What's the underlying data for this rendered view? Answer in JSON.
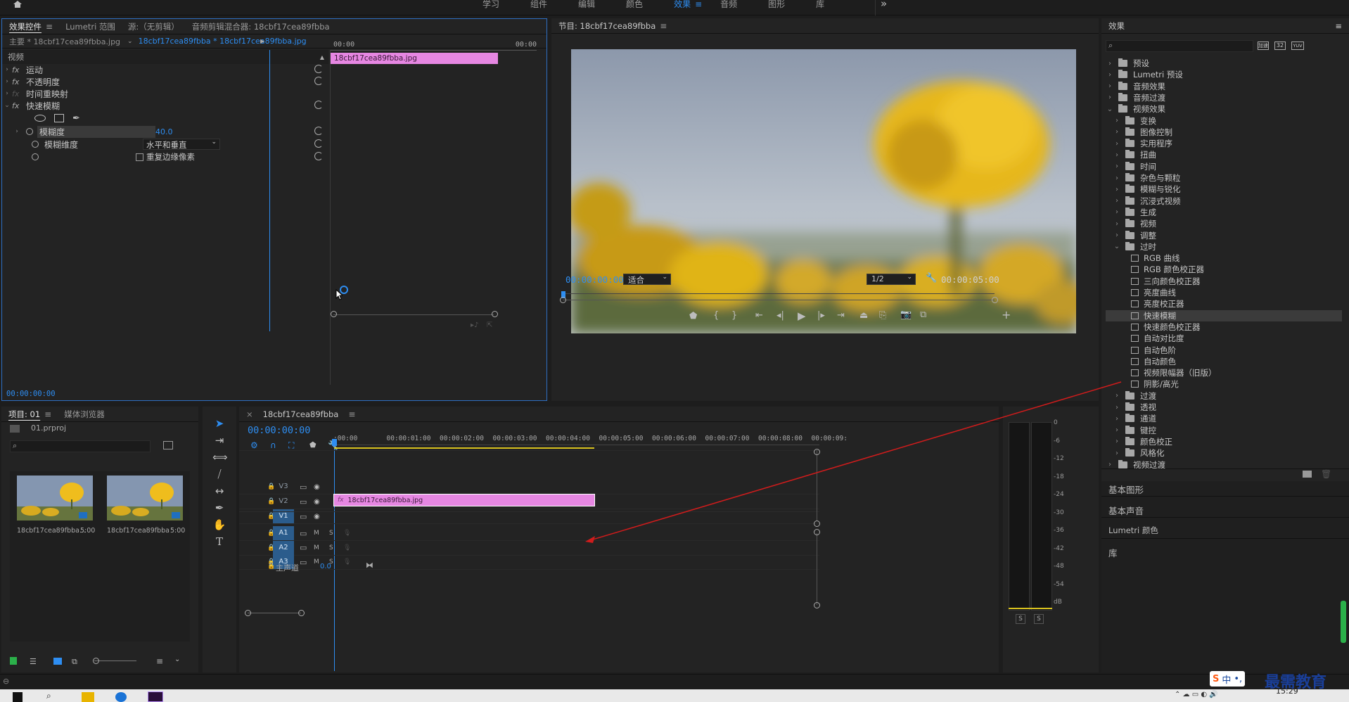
{
  "workspaces": [
    "学习",
    "组件",
    "编辑",
    "颜色",
    "效果",
    "音频",
    "图形",
    "库"
  ],
  "workspace_active_index": 4,
  "workspace_more": "»",
  "effect_controls": {
    "tabs": [
      "效果控件",
      "Lumetri 范围",
      "源:（无剪辑）",
      "音频剪辑混合器: 18cbf17cea89fbba"
    ],
    "menu_glyph": "≡",
    "master_label": "主要 * 18cbf17cea89fbba.jpg",
    "sequence_clip": "18cbf17cea89fbba * 18cbf17cea89fbba.jpg",
    "section": "视频",
    "rows": [
      {
        "fx": "fx",
        "label": "运动"
      },
      {
        "fx": "fx",
        "label": "不透明度"
      },
      {
        "fx": "fx",
        "label": "时间重映射"
      },
      {
        "fx": "fx",
        "label": "快速模糊"
      }
    ],
    "blurriness_label": "模糊度",
    "blurriness_value": "40.0",
    "blur_dim_label": "模糊维度",
    "blur_dim_value": "水平和垂直",
    "repeat_edge_label": "重复边缘像素",
    "tl_start": "00:00",
    "tl_end": "00:00",
    "clip_name": "18cbf17cea89fbba.jpg",
    "timecode": "00:00:00:00"
  },
  "program": {
    "title": "节目: 18cbf17cea89fbba",
    "timecode": "00:00:00:00",
    "fit": "适合",
    "resolution": "1/2",
    "duration": "00:00:05:00",
    "add": "+"
  },
  "effects_panel": {
    "title": "效果",
    "search_placeholder": "",
    "icons": [
      "加速",
      "32",
      "YUV"
    ],
    "tree": [
      {
        "label": "预设",
        "depth": 0,
        "open": false
      },
      {
        "label": "Lumetri 预设",
        "depth": 0,
        "open": false
      },
      {
        "label": "音频效果",
        "depth": 0,
        "open": false
      },
      {
        "label": "音频过渡",
        "depth": 0,
        "open": false
      },
      {
        "label": "视频效果",
        "depth": 0,
        "open": true
      },
      {
        "label": "变换",
        "depth": 1,
        "open": false
      },
      {
        "label": "图像控制",
        "depth": 1,
        "open": false
      },
      {
        "label": "实用程序",
        "depth": 1,
        "open": false
      },
      {
        "label": "扭曲",
        "depth": 1,
        "open": false
      },
      {
        "label": "时间",
        "depth": 1,
        "open": false
      },
      {
        "label": "杂色与颗粒",
        "depth": 1,
        "open": false
      },
      {
        "label": "模糊与锐化",
        "depth": 1,
        "open": false
      },
      {
        "label": "沉浸式视频",
        "depth": 1,
        "open": false
      },
      {
        "label": "生成",
        "depth": 1,
        "open": false
      },
      {
        "label": "视频",
        "depth": 1,
        "open": false
      },
      {
        "label": "调整",
        "depth": 1,
        "open": false
      },
      {
        "label": "过时",
        "depth": 1,
        "open": true
      },
      {
        "label": "RGB 曲线",
        "depth": 2,
        "item": true
      },
      {
        "label": "RGB 颜色校正器",
        "depth": 2,
        "item": true
      },
      {
        "label": "三向颜色校正器",
        "depth": 2,
        "item": true
      },
      {
        "label": "亮度曲线",
        "depth": 2,
        "item": true
      },
      {
        "label": "亮度校正器",
        "depth": 2,
        "item": true
      },
      {
        "label": "快速模糊",
        "depth": 2,
        "item": true,
        "selected": true
      },
      {
        "label": "快速颜色校正器",
        "depth": 2,
        "item": true
      },
      {
        "label": "自动对比度",
        "depth": 2,
        "item": true
      },
      {
        "label": "自动色阶",
        "depth": 2,
        "item": true
      },
      {
        "label": "自动颜色",
        "depth": 2,
        "item": true
      },
      {
        "label": "视频限幅器（旧版）",
        "depth": 2,
        "item": true
      },
      {
        "label": "阴影/高光",
        "depth": 2,
        "item": true
      },
      {
        "label": "过渡",
        "depth": 1,
        "open": false
      },
      {
        "label": "透视",
        "depth": 1,
        "open": false
      },
      {
        "label": "通道",
        "depth": 1,
        "open": false
      },
      {
        "label": "键控",
        "depth": 1,
        "open": false
      },
      {
        "label": "颜色校正",
        "depth": 1,
        "open": false
      },
      {
        "label": "风格化",
        "depth": 1,
        "open": false
      },
      {
        "label": "视频过渡",
        "depth": 0,
        "open": false
      }
    ],
    "lower": [
      "基本图形",
      "基本声音",
      "Lumetri 颜色",
      "库"
    ]
  },
  "project": {
    "tabs": [
      "项目: 01",
      "媒体浏览器"
    ],
    "file": "01.prproj",
    "items": [
      {
        "name": "18cbf17cea89fbba...",
        "duration": "5:00"
      },
      {
        "name": "18cbf17cea89fbba",
        "duration": "5:00"
      }
    ]
  },
  "timeline": {
    "seq_name": "18cbf17cea89fbba",
    "timecode": "00:00:00:00",
    "ruler": [
      ":00:00",
      "00:00:01:00",
      "00:00:02:00",
      "00:00:03:00",
      "00:00:04:00",
      "00:00:05:00",
      "00:00:06:00",
      "00:00:07:00",
      "00:00:08:00",
      "00:00:09:"
    ],
    "video_tracks": [
      "V3",
      "V2",
      "V1"
    ],
    "audio_tracks": [
      "A1",
      "A2",
      "A3"
    ],
    "master": "主声道",
    "master_value": "0.0",
    "clip": "18cbf17cea89fbba.jpg",
    "m": "M",
    "s": "S"
  },
  "meter": {
    "scale": [
      "0",
      "-6",
      "-12",
      "-18",
      "-24",
      "-30",
      "-36",
      "-42",
      "-48",
      "-54",
      "dB"
    ],
    "solo": [
      "S",
      "S"
    ]
  },
  "taskbar": {
    "ime": "中",
    "brand": "最需教育",
    "time": "15:29"
  },
  "colors": {
    "accent_blue": "#2e8ef2",
    "clip_pink": "#e687e2",
    "panel_bg": "#232323",
    "arrow_red": "#d01c1c"
  }
}
